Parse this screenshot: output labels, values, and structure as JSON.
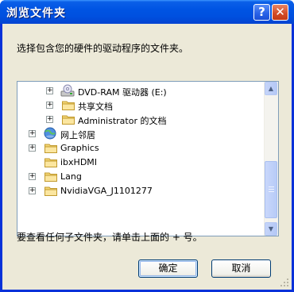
{
  "window": {
    "title": "浏览文件夹",
    "help_glyph": "?",
    "close_glyph": "✕"
  },
  "prompt": "选择包含您的硬件的驱动程序的文件夹。",
  "tree": {
    "items": [
      {
        "label": "DVD-RAM 驱动器 (E:)",
        "icon": "dvd-drive-icon",
        "expander": "+"
      },
      {
        "label": "共享文档",
        "icon": "folder-icon",
        "expander": "+"
      },
      {
        "label": "Administrator 的文档",
        "icon": "folder-icon",
        "expander": "+"
      },
      {
        "label": "网上邻居",
        "icon": "network-icon",
        "expander": "+"
      },
      {
        "label": "Graphics",
        "icon": "folder-icon",
        "expander": "+"
      },
      {
        "label": "ibxHDMI",
        "icon": "folder-icon",
        "expander": ""
      },
      {
        "label": "Lang",
        "icon": "folder-icon",
        "expander": "+"
      },
      {
        "label": "NvidiaVGA_J1101277",
        "icon": "folder-icon",
        "expander": "+"
      }
    ]
  },
  "scrollbar": {
    "up_glyph": "▲",
    "down_glyph": "▼"
  },
  "hint": "要查看任何子文件夹，请单击上面的 + 号。",
  "buttons": {
    "ok": "确定",
    "cancel": "取消"
  },
  "colors": {
    "title_bar": "#0054e3",
    "dialog_bg": "#ece9d8",
    "folder": "#f4d675"
  }
}
